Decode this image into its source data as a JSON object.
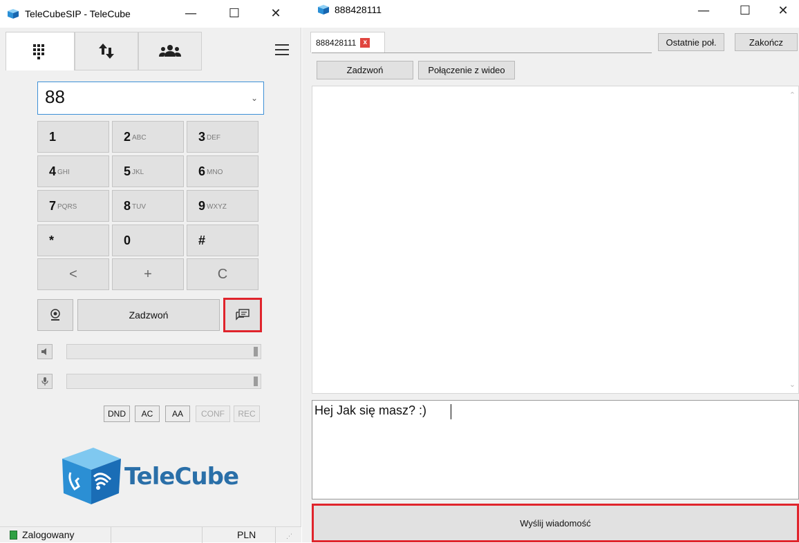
{
  "left_window": {
    "title": "TeleCubeSIP - TeleCube",
    "controls": {
      "minimize": "—",
      "maximize": "☐",
      "close": "✕"
    },
    "tabs": [
      {
        "icon": "dialpad-icon",
        "active": true
      },
      {
        "icon": "transfer-icon",
        "active": false
      },
      {
        "icon": "contacts-icon",
        "active": false
      }
    ],
    "number_value": "88",
    "keypad": [
      {
        "digit": "1",
        "letters": ""
      },
      {
        "digit": "2",
        "letters": "ABC"
      },
      {
        "digit": "3",
        "letters": "DEF"
      },
      {
        "digit": "4",
        "letters": "GHI"
      },
      {
        "digit": "5",
        "letters": "JKL"
      },
      {
        "digit": "6",
        "letters": "MNO"
      },
      {
        "digit": "7",
        "letters": "PQRS"
      },
      {
        "digit": "8",
        "letters": "TUV"
      },
      {
        "digit": "9",
        "letters": "WXYZ"
      },
      {
        "digit": "*",
        "letters": ""
      },
      {
        "digit": "0",
        "letters": ""
      },
      {
        "digit": "#",
        "letters": ""
      }
    ],
    "func_keys": [
      "<",
      "+",
      "C"
    ],
    "call_button": "Zadzwoń",
    "flags": [
      {
        "label": "DND",
        "enabled": true
      },
      {
        "label": "AC",
        "enabled": true
      },
      {
        "label": "AA",
        "enabled": true
      },
      {
        "label": "CONF",
        "enabled": false
      },
      {
        "label": "REC",
        "enabled": false
      }
    ],
    "logo_text": "TeleCube",
    "status": {
      "text": "Zalogowany",
      "currency": "PLN"
    },
    "accent_red": "#e0242c"
  },
  "right_window": {
    "title": "888428111",
    "controls": {
      "minimize": "—",
      "maximize": "☐",
      "close": "✕"
    },
    "tab_label": "888428111",
    "tab_close": "x",
    "recent_button": "Ostatnie poł.",
    "end_button": "Zakończ",
    "call_button": "Zadzwoń",
    "video_button": "Połączenie z wideo",
    "compose_text": "Hej Jak się masz? :)",
    "send_button": "Wyślij wiadomość"
  }
}
